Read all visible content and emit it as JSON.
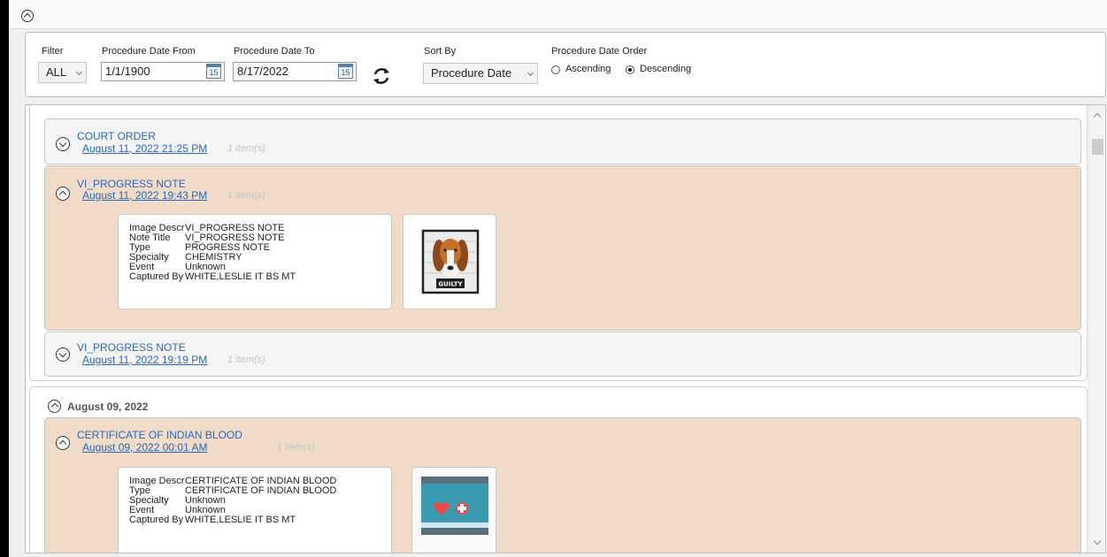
{
  "filters": {
    "filter_label": "Filter",
    "filter_value": "ALL",
    "date_from_label": "Procedure Date From",
    "date_from_value": "1/1/1900",
    "date_to_label": "Procedure Date To",
    "date_to_value": "8/17/2022",
    "calendar_icon_text": "15",
    "sort_by_label": "Sort By",
    "sort_by_value": "Procedure Date",
    "order_label": "Procedure Date Order",
    "ascending_label": "Ascending",
    "descending_label": "Descending",
    "order_selected": "Descending"
  },
  "group1": {
    "docs": [
      {
        "title": "COURT ORDER",
        "date": "August 11, 2022 21:25 PM",
        "count": "1 item(s)",
        "expanded": false
      },
      {
        "title": "VI_PROGRESS NOTE",
        "date": "August 11, 2022 19:43 PM",
        "count": "1 item(s)",
        "expanded": true,
        "details": [
          {
            "key": "Image Descr",
            "value": "VI_PROGRESS NOTE"
          },
          {
            "key": "Note Title",
            "value": "VI_PROGRESS NOTE"
          },
          {
            "key": "Type",
            "value": "PROGRESS NOTE"
          },
          {
            "key": "Specialty",
            "value": "CHEMISTRY"
          },
          {
            "key": "Event",
            "value": "Unknown"
          },
          {
            "key": "Captured By",
            "value": "WHITE,LESLIE IT BS MT"
          }
        ],
        "thumbnail_text": "GUILTY"
      },
      {
        "title": "VI_PROGRESS NOTE",
        "date": "August 11, 2022 19:19 PM",
        "count": "1 item(s)",
        "expanded": false
      }
    ]
  },
  "group2": {
    "label": "August 09, 2022",
    "docs": [
      {
        "title": "CERTIFICATE OF INDIAN BLOOD",
        "date": "August 09, 2022 00:01 AM",
        "count": "1 item(s)",
        "expanded": true,
        "details": [
          {
            "key": "Image Descr",
            "value": "CERTIFICATE OF INDIAN BLOOD"
          },
          {
            "key": "Type",
            "value": "CERTIFICATE OF INDIAN BLOOD"
          },
          {
            "key": "Specialty",
            "value": "Unknown"
          },
          {
            "key": "Event",
            "value": "Unknown"
          },
          {
            "key": "Captured By",
            "value": "WHITE,LESLIE IT BS MT"
          }
        ]
      }
    ]
  },
  "colors": {
    "link": "#2a67b8",
    "expanded_bg": "#f0dcc8",
    "collapsed_bg": "#f5f5f5"
  }
}
